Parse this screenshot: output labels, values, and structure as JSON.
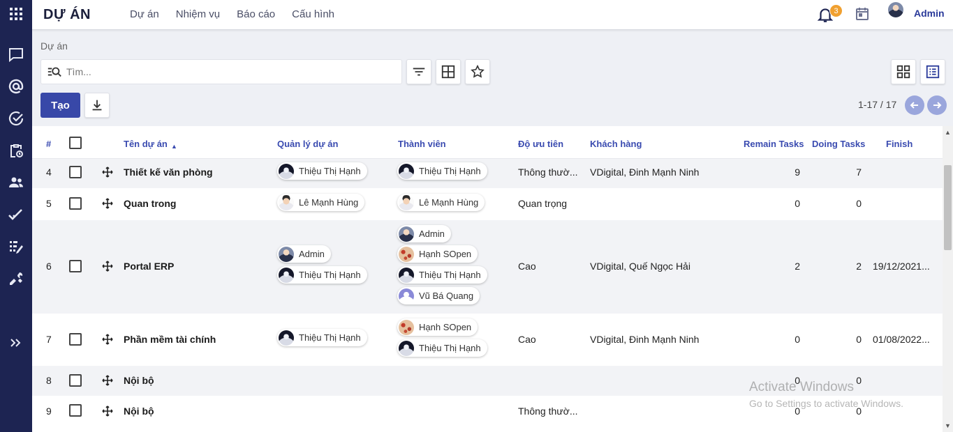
{
  "app": {
    "title": "DỰ ÁN",
    "user_name": "Admin",
    "notification_count": "3"
  },
  "menu": [
    "Dự án",
    "Nhiệm vụ",
    "Báo cáo",
    "Cấu hình"
  ],
  "sidebar_icons": [
    "apps-grid-icon",
    "chat-icon",
    "mention-icon",
    "check-circle-icon",
    "clipboard-clock-icon",
    "people-icon",
    "double-check-icon",
    "task-list-icon",
    "tools-icon",
    "expand-icon"
  ],
  "breadcrumb": "Dự án",
  "search": {
    "placeholder": "Tìm..."
  },
  "toolbar": {
    "create_label": "Tạo"
  },
  "pager": {
    "text": "1-17 / 17"
  },
  "table": {
    "headers": {
      "index": "#",
      "name": "Tên dự án",
      "manager": "Quản lý dự án",
      "members": "Thành viên",
      "priority": "Độ ưu tiên",
      "customer": "Khách hàng",
      "remain": "Remain Tasks",
      "doing": "Doing Tasks",
      "finish": "Finish"
    },
    "rows": [
      {
        "index": "4",
        "name": "Thiết kế văn phòng",
        "managers": [
          "Thiệu Thị Hạnh"
        ],
        "members": [
          "Thiệu Thị Hạnh"
        ],
        "priority": "Thông thườ...",
        "customer": "VDigital, Đinh Mạnh Ninh",
        "remain": "9",
        "doing": "7",
        "finish": ""
      },
      {
        "index": "5",
        "name": "Quan trong",
        "managers": [
          "Lê Mạnh Hùng"
        ],
        "members": [
          "Lê Mạnh Hùng"
        ],
        "priority": "Quan trọng",
        "customer": "",
        "remain": "0",
        "doing": "0",
        "finish": ""
      },
      {
        "index": "6",
        "name": "Portal ERP",
        "managers": [
          "Admin",
          "Thiệu Thị Hạnh"
        ],
        "members": [
          "Admin",
          "Hạnh SOpen",
          "Thiệu Thị Hạnh",
          "Vũ Bá Quang"
        ],
        "priority": "Cao",
        "customer": "VDigital, Quế Ngọc Hải",
        "remain": "2",
        "doing": "2",
        "finish": "19/12/2021..."
      },
      {
        "index": "7",
        "name": "Phần mềm tài chính",
        "managers": [
          "Thiệu Thị Hạnh"
        ],
        "members": [
          "Hạnh SOpen",
          "Thiệu Thị Hạnh"
        ],
        "priority": "Cao",
        "customer": "VDigital, Đinh Mạnh Ninh",
        "remain": "0",
        "doing": "0",
        "finish": "01/08/2022..."
      },
      {
        "index": "8",
        "name": "Nội bộ",
        "managers": [],
        "members": [],
        "priority": "",
        "customer": "",
        "remain": "0",
        "doing": "0",
        "finish": ""
      },
      {
        "index": "9",
        "name": "Nội bộ",
        "managers": [],
        "members": [],
        "priority": "Thông thườ...",
        "customer": "",
        "remain": "0",
        "doing": "0",
        "finish": ""
      }
    ]
  },
  "watermark": {
    "line1": "Activate Windows",
    "line2": "Go to Settings to activate Windows."
  }
}
